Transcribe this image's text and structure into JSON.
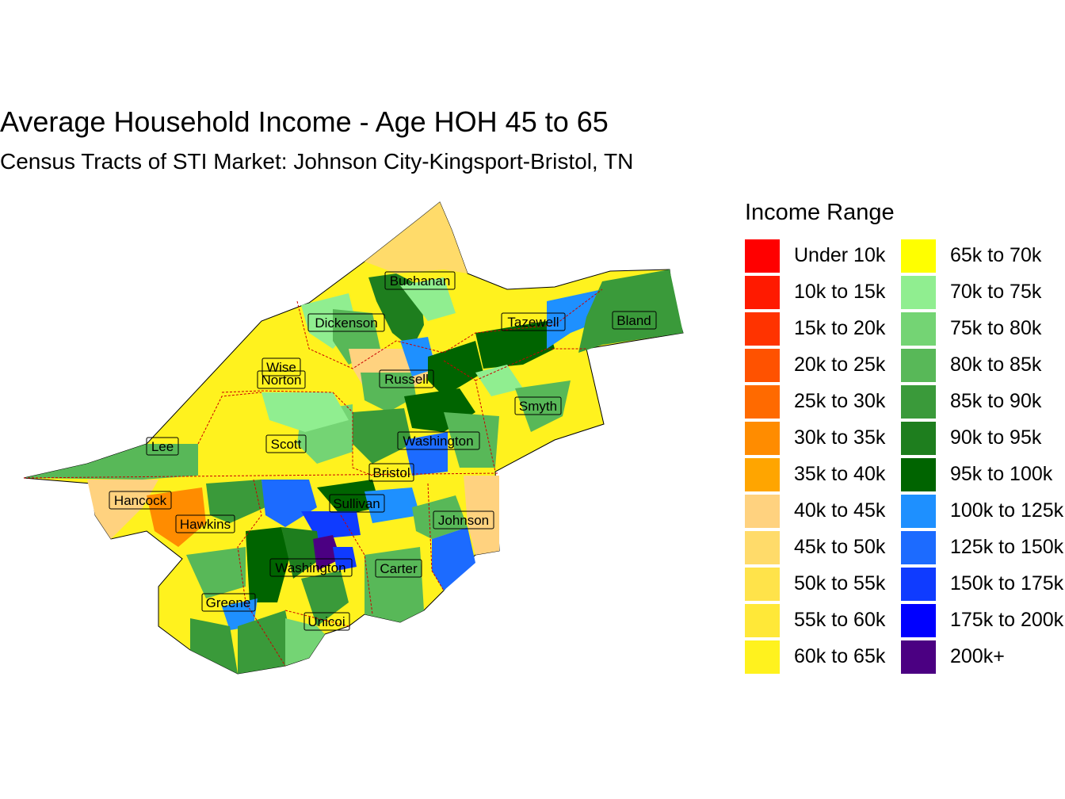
{
  "title": "Average Household Income - Age HOH 45 to 65",
  "subtitle": "Census Tracts of STI Market: Johnson City-Kingsport-Bristol, TN",
  "legend": {
    "title": "Income Range",
    "items": [
      {
        "label": "Under 10k",
        "color": "#FF0000"
      },
      {
        "label": "10k to 15k",
        "color": "#FF1A00"
      },
      {
        "label": "15k to 20k",
        "color": "#FF3300"
      },
      {
        "label": "20k to 25k",
        "color": "#FF5200"
      },
      {
        "label": "25k to 30k",
        "color": "#FF6A00"
      },
      {
        "label": "30k to 35k",
        "color": "#FF8C00"
      },
      {
        "label": "35k to 40k",
        "color": "#FFA500"
      },
      {
        "label": "40k to 45k",
        "color": "#FFD27F"
      },
      {
        "label": "45k to 50k",
        "color": "#FFDB6A"
      },
      {
        "label": "50k to 55k",
        "color": "#FFE34A"
      },
      {
        "label": "55k to 60k",
        "color": "#FFE838"
      },
      {
        "label": "60k to 65k",
        "color": "#FFF21E"
      },
      {
        "label": "65k to 70k",
        "color": "#FFFF00"
      },
      {
        "label": "70k to 75k",
        "color": "#90EE90"
      },
      {
        "label": "75k to 80k",
        "color": "#74D474"
      },
      {
        "label": "80k to 85k",
        "color": "#58B858"
      },
      {
        "label": "85k to 90k",
        "color": "#3A9A3A"
      },
      {
        "label": "90k to 95k",
        "color": "#1E7E1E"
      },
      {
        "label": "95k to 100k",
        "color": "#006400"
      },
      {
        "label": "100k to 125k",
        "color": "#1E90FF"
      },
      {
        "label": "125k to 150k",
        "color": "#1C6BFF"
      },
      {
        "label": "150k to 175k",
        "color": "#0F3BFF"
      },
      {
        "label": "175k to 200k",
        "color": "#0000FF"
      },
      {
        "label": "200k+",
        "color": "#4B0082"
      }
    ]
  },
  "counties": {
    "buchanan": "Buchanan",
    "dickenson": "Dickenson",
    "tazewell": "Tazewell",
    "bland": "Bland",
    "wise": "Wise",
    "norton": "Norton",
    "russell": "Russell",
    "smyth": "Smyth",
    "lee": "Lee",
    "scott": "Scott",
    "washington_va": "Washington",
    "bristol": "Bristol",
    "hancock": "Hancock",
    "sullivan": "Sullivan",
    "hawkins": "Hawkins",
    "johnson": "Johnson",
    "washington_tn": "Washington",
    "carter": "Carter",
    "greene": "Greene",
    "unicoi": "Unicoi"
  }
}
